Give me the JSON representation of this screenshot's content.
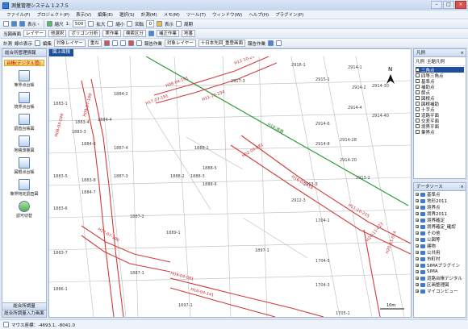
{
  "window": {
    "title": "測量管理システム 1.2.7.5"
  },
  "menu": [
    "ファイル(F)",
    "プロジェクト(P)",
    "表示(V)",
    "編集(E)",
    "選択(S)",
    "計測(M)",
    "メモ(M)",
    "ツール(T)",
    "ウィンドウ(W)",
    "ヘルプ(H)",
    "プラグイン(P)"
  ],
  "toolbar1": {
    "table_label": "表示・",
    "zoom_label": "縮尺",
    "scale_value": "1:",
    "scale_input": "500",
    "zoom_in": "拡大",
    "zoom_out": "縮小",
    "rotate": "回転",
    "rotate_value": "0",
    "display_label": "表示",
    "fit_label": "周期"
  },
  "toolbar2": {
    "layer_label": "当図画面",
    "layer_sel": "レイヤー",
    "type_sel": "他選択",
    "range_sel": "ポリゴン分析",
    "edit_sel": "実作業",
    "search_sel": "検索区分",
    "mode_sel": "補正作業",
    "geo_sel": "地番"
  },
  "toolbar3": {
    "measure": "計測",
    "show": "線の表示",
    "edit": "編集",
    "target_layer": "対象レイヤー",
    "overlay": "重ね",
    "report": "報告作業",
    "target_layer2": "対象レイヤー",
    "parcel_sel": "十日本先回_重登画面",
    "report2": "報告作業"
  },
  "left_panel": {
    "title": "総合所管理情報",
    "category": "台帳(デジタル管)",
    "items": [
      "筆界点台帳",
      "境界点台帳",
      "調査台帳図",
      "地積測量図",
      "図根点台帳",
      "筆界特定調査図",
      "認可切替"
    ],
    "bottom1": "総合所調量",
    "bottom2": "総合所調量入力画面"
  },
  "map": {
    "tab": "図上面積",
    "parcels": [
      "1883-1",
      "1883-3",
      "1883-4",
      "1883-5",
      "1883-6",
      "1883-7",
      "1883-8",
      "1884-2",
      "1884-4",
      "1884-6",
      "1884-7",
      "1886-1",
      "1887-1",
      "1887-2",
      "1887-3",
      "1887-4",
      "1888-1",
      "1888-2",
      "1888-3",
      "1888-5",
      "1888-6",
      "1889-1",
      "1897-1",
      "1697-1",
      "1704-1",
      "1704-3",
      "1704-5",
      "1705-1",
      "2917-3",
      "2916-1",
      "2915-1",
      "2914-1",
      "2914-2",
      "2914-4",
      "2914-6",
      "2914-8",
      "2914-20",
      "2914-28",
      "2914-30",
      "2914-40",
      "2913-2",
      "2913-3",
      "2912-3"
    ],
    "road_labels": [
      "H08-04-191",
      "H09-07-189",
      "H17-07-191",
      "H11-10-234",
      "H11-10-204",
      "H16-02-419",
      "H02-04-081",
      "H11-10-215",
      "H20-11-023",
      "H20-11-024",
      "H17-07-190",
      "H09-04-081",
      "H16-04-141",
      "H08-04-049"
    ],
    "green_label": "H18-道路",
    "north": "N",
    "scale_text": "10m"
  },
  "legend_panel": {
    "title": "凡例",
    "tabs": [
      "凡例",
      "主題凡例"
    ],
    "items": [
      "三角点",
      "四等三角点",
      "基準点",
      "補助点",
      "節点",
      "図根点",
      "図根補助",
      "十字点",
      "道路平面",
      "交差平面",
      "境界平面",
      "筆界点"
    ]
  },
  "data_panel": {
    "title": "データソース",
    "items": [
      "基準点",
      "地形2011",
      "境界点",
      "境界2011",
      "境界確定",
      "境界確定_確認",
      "その他",
      "公図等",
      "建物",
      "公共用",
      "市町村",
      "SIMAプラグイン",
      "SIMA",
      "道路台帳デジタル",
      "区画整理図",
      "マイコンビュー"
    ]
  },
  "status": {
    "text": "マウス座標：-4693.1, -8041.0"
  }
}
